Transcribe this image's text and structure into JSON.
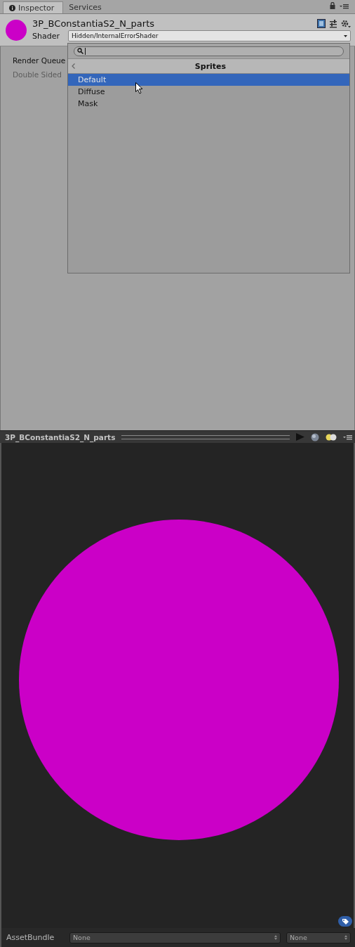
{
  "tabs": [
    {
      "label": "Inspector",
      "selected": true
    },
    {
      "label": "Services",
      "selected": false
    }
  ],
  "material": {
    "name": "3P_BConstantiaS2_N_parts",
    "shader_label": "Shader",
    "shader": "Hidden/InternalErrorShader"
  },
  "properties": [
    {
      "label": "Render Queue",
      "disabled": false
    },
    {
      "label": "Double Sided",
      "disabled": true
    }
  ],
  "shader_menu": {
    "title": "Sprites",
    "items": [
      {
        "label": "Default",
        "selected": true
      },
      {
        "label": "Diffuse",
        "selected": false
      },
      {
        "label": "Mask",
        "selected": false
      }
    ]
  },
  "preview": {
    "title": "3P_BConstantiaS2_N_parts"
  },
  "asset_bundle": {
    "label": "AssetBundle",
    "name": "None",
    "variant": "None"
  }
}
